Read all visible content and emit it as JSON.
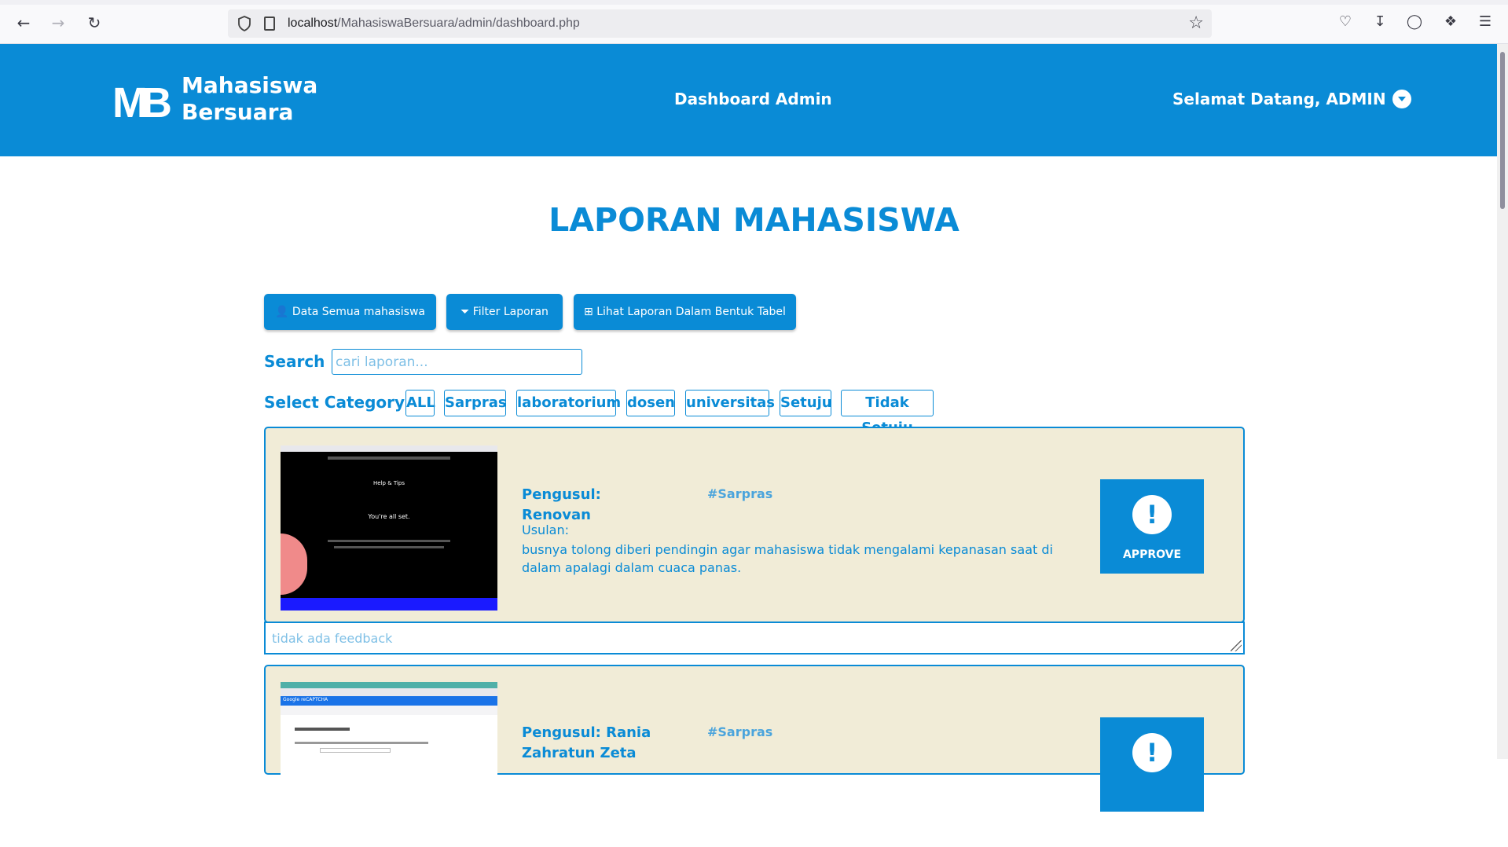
{
  "browser": {
    "url_host": "localhost",
    "url_path": "/MahasiswaBersuara/admin/dashboard.php"
  },
  "header": {
    "logo_mark": "MB",
    "logo_line1": "Mahasiswa",
    "logo_line2": "Bersuara",
    "center_title": "Dashboard Admin",
    "welcome": "Selamat Datang, ADMIN"
  },
  "main": {
    "title": "LAPORAN MAHASISWA",
    "buttons": {
      "students": "Data Semua mahasiswa",
      "filter": "Filter Laporan",
      "table": "Lihat Laporan Dalam Bentuk Tabel"
    },
    "search": {
      "label": "Search :",
      "placeholder": "cari laporan..."
    },
    "category": {
      "label": "Select Category :",
      "items": [
        "ALL",
        "Sarpras",
        "laboratorium",
        "dosen",
        "universitas",
        "Setuju",
        "Tidak Setuju"
      ]
    },
    "reports": [
      {
        "proposer": "Pengusul: Renovan",
        "tag": "#Sarpras",
        "usulan_label": "Usulan:",
        "usulan_text": "busnya tolong diberi pendingin agar mahasiswa tidak mengalami kepanasan saat di dalam apalagi dalam cuaca panas.",
        "approve_label": "APPROVE",
        "thumb": {
          "line1": "Help & Tips",
          "line2": "You're all set."
        },
        "feedback_placeholder": "tidak ada feedback"
      },
      {
        "proposer": "Pengusul: Rania Zahratun Zeta",
        "tag": "#Sarpras",
        "thumb": {
          "line1": "Google reCAPTCHA"
        }
      }
    ]
  }
}
